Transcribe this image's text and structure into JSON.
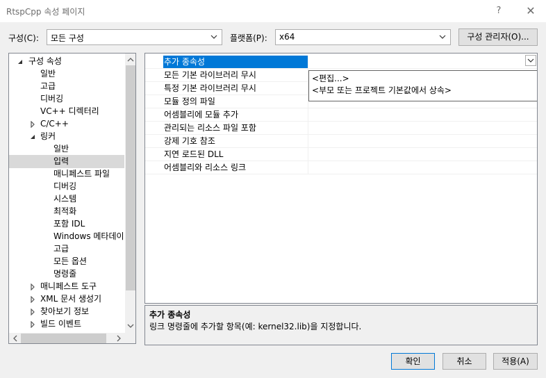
{
  "window": {
    "title": "RtspCpp 속성 페이지",
    "help": "?",
    "close": "✕"
  },
  "toolbar": {
    "config_label": "구성(C):",
    "config_value": "모든 구성",
    "platform_label": "플랫폼(P):",
    "platform_value": "x64",
    "config_manager": "구성 관리자(O)..."
  },
  "tree": {
    "items": [
      {
        "label": "구성 속성",
        "state": "expanded"
      },
      {
        "label": "일반"
      },
      {
        "label": "고급"
      },
      {
        "label": "디버깅"
      },
      {
        "label": "VC++ 디렉터리"
      },
      {
        "label": "C/C++",
        "state": "collapsed"
      },
      {
        "label": "링커",
        "state": "expanded"
      },
      {
        "label": "일반"
      },
      {
        "label": "입력",
        "selected": true
      },
      {
        "label": "매니페스트 파일"
      },
      {
        "label": "디버깅"
      },
      {
        "label": "시스템"
      },
      {
        "label": "최적화"
      },
      {
        "label": "포함 IDL"
      },
      {
        "label": "Windows 메타데이"
      },
      {
        "label": "고급"
      },
      {
        "label": "모든 옵션"
      },
      {
        "label": "명령줄"
      },
      {
        "label": "매니페스트 도구",
        "state": "collapsed"
      },
      {
        "label": "XML 문서 생성기",
        "state": "collapsed"
      },
      {
        "label": "찾아보기 정보",
        "state": "collapsed"
      },
      {
        "label": "빌드 이벤트",
        "state": "collapsed"
      }
    ]
  },
  "grid": {
    "rows": [
      {
        "name": "추가 종속성",
        "value": "",
        "selected": true
      },
      {
        "name": "모든 기본 라이브러리 무시",
        "value": ""
      },
      {
        "name": "특정 기본 라이브러리 무시",
        "value": ""
      },
      {
        "name": "모듈 정의 파일",
        "value": ""
      },
      {
        "name": "어셈블리에 모듈 추가",
        "value": ""
      },
      {
        "name": "관리되는 리소스 파일 포함",
        "value": ""
      },
      {
        "name": "강제 기호 참조",
        "value": ""
      },
      {
        "name": "지연 로드된 DLL",
        "value": ""
      },
      {
        "name": "어셈블리와 리소스 링크",
        "value": ""
      }
    ],
    "dropdown_options": [
      "<편집...>",
      "<부모 또는 프로젝트 기본값에서 상속>"
    ]
  },
  "description": {
    "title": "추가 종속성",
    "text": "링크 명령줄에 추가할 항목(예: kernel32.lib)을 지정합니다."
  },
  "buttons": {
    "ok": "확인",
    "cancel": "취소",
    "apply": "적용(A)"
  }
}
